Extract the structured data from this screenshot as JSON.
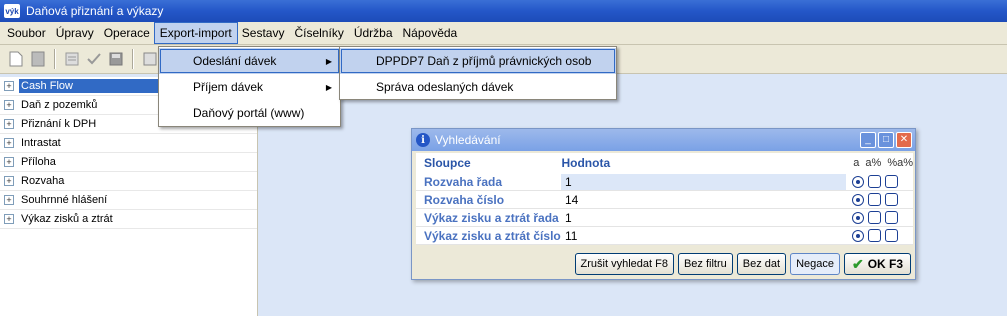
{
  "window": {
    "title": "Daňová přiznání a výkazy",
    "app_icon_text": "výk"
  },
  "menubar": {
    "items": [
      "Soubor",
      "Úpravy",
      "Operace",
      "Export-import",
      "Sestavy",
      "Číselníky",
      "Údržba",
      "Nápověda"
    ],
    "active": "Export-import"
  },
  "export_menu": {
    "items": [
      {
        "label": "Odeslání dávek",
        "has_submenu": true
      },
      {
        "label": "Příjem dávek",
        "has_submenu": true
      },
      {
        "label": "Daňový portál (www)",
        "has_submenu": false
      }
    ]
  },
  "submenu": {
    "items": [
      {
        "label": "DPPDP7 Daň z příjmů právnických osob"
      },
      {
        "label": "Správa odeslaných dávek"
      }
    ]
  },
  "tree": {
    "items": [
      "Cash Flow",
      "Daň z pozemků",
      "Přiznání k DPH",
      "Intrastat",
      "Příloha",
      "Rozvaha",
      "Souhrnné hlášení",
      "Výkaz zisků a ztrát"
    ],
    "selected": "Cash Flow"
  },
  "dialog": {
    "title": "Vyhledávání",
    "headers": {
      "columns": "Sloupce",
      "value": "Hodnota",
      "opt1": "a",
      "opt2": "a%",
      "opt3": "%a%"
    },
    "rows": [
      {
        "column": "Rozvaha řada",
        "value": "1"
      },
      {
        "column": "Rozvaha číslo",
        "value": "14"
      },
      {
        "column": "Výkaz zisku a ztrát řada",
        "value": "1"
      },
      {
        "column": "Výkaz zisku a ztrát číslo",
        "value": "11"
      }
    ],
    "buttons": {
      "cancel_search": "Zrušit vyhledat F8",
      "no_filter": "Bez filtru",
      "no_data": "Bez dat",
      "negate": "Negace",
      "ok": "OK F3"
    }
  },
  "colors": {
    "titlebar": "#2457c8",
    "selection": "#316ac5",
    "desktop": "#dbe6f7",
    "menu_highlight": "#c1d2ee"
  }
}
